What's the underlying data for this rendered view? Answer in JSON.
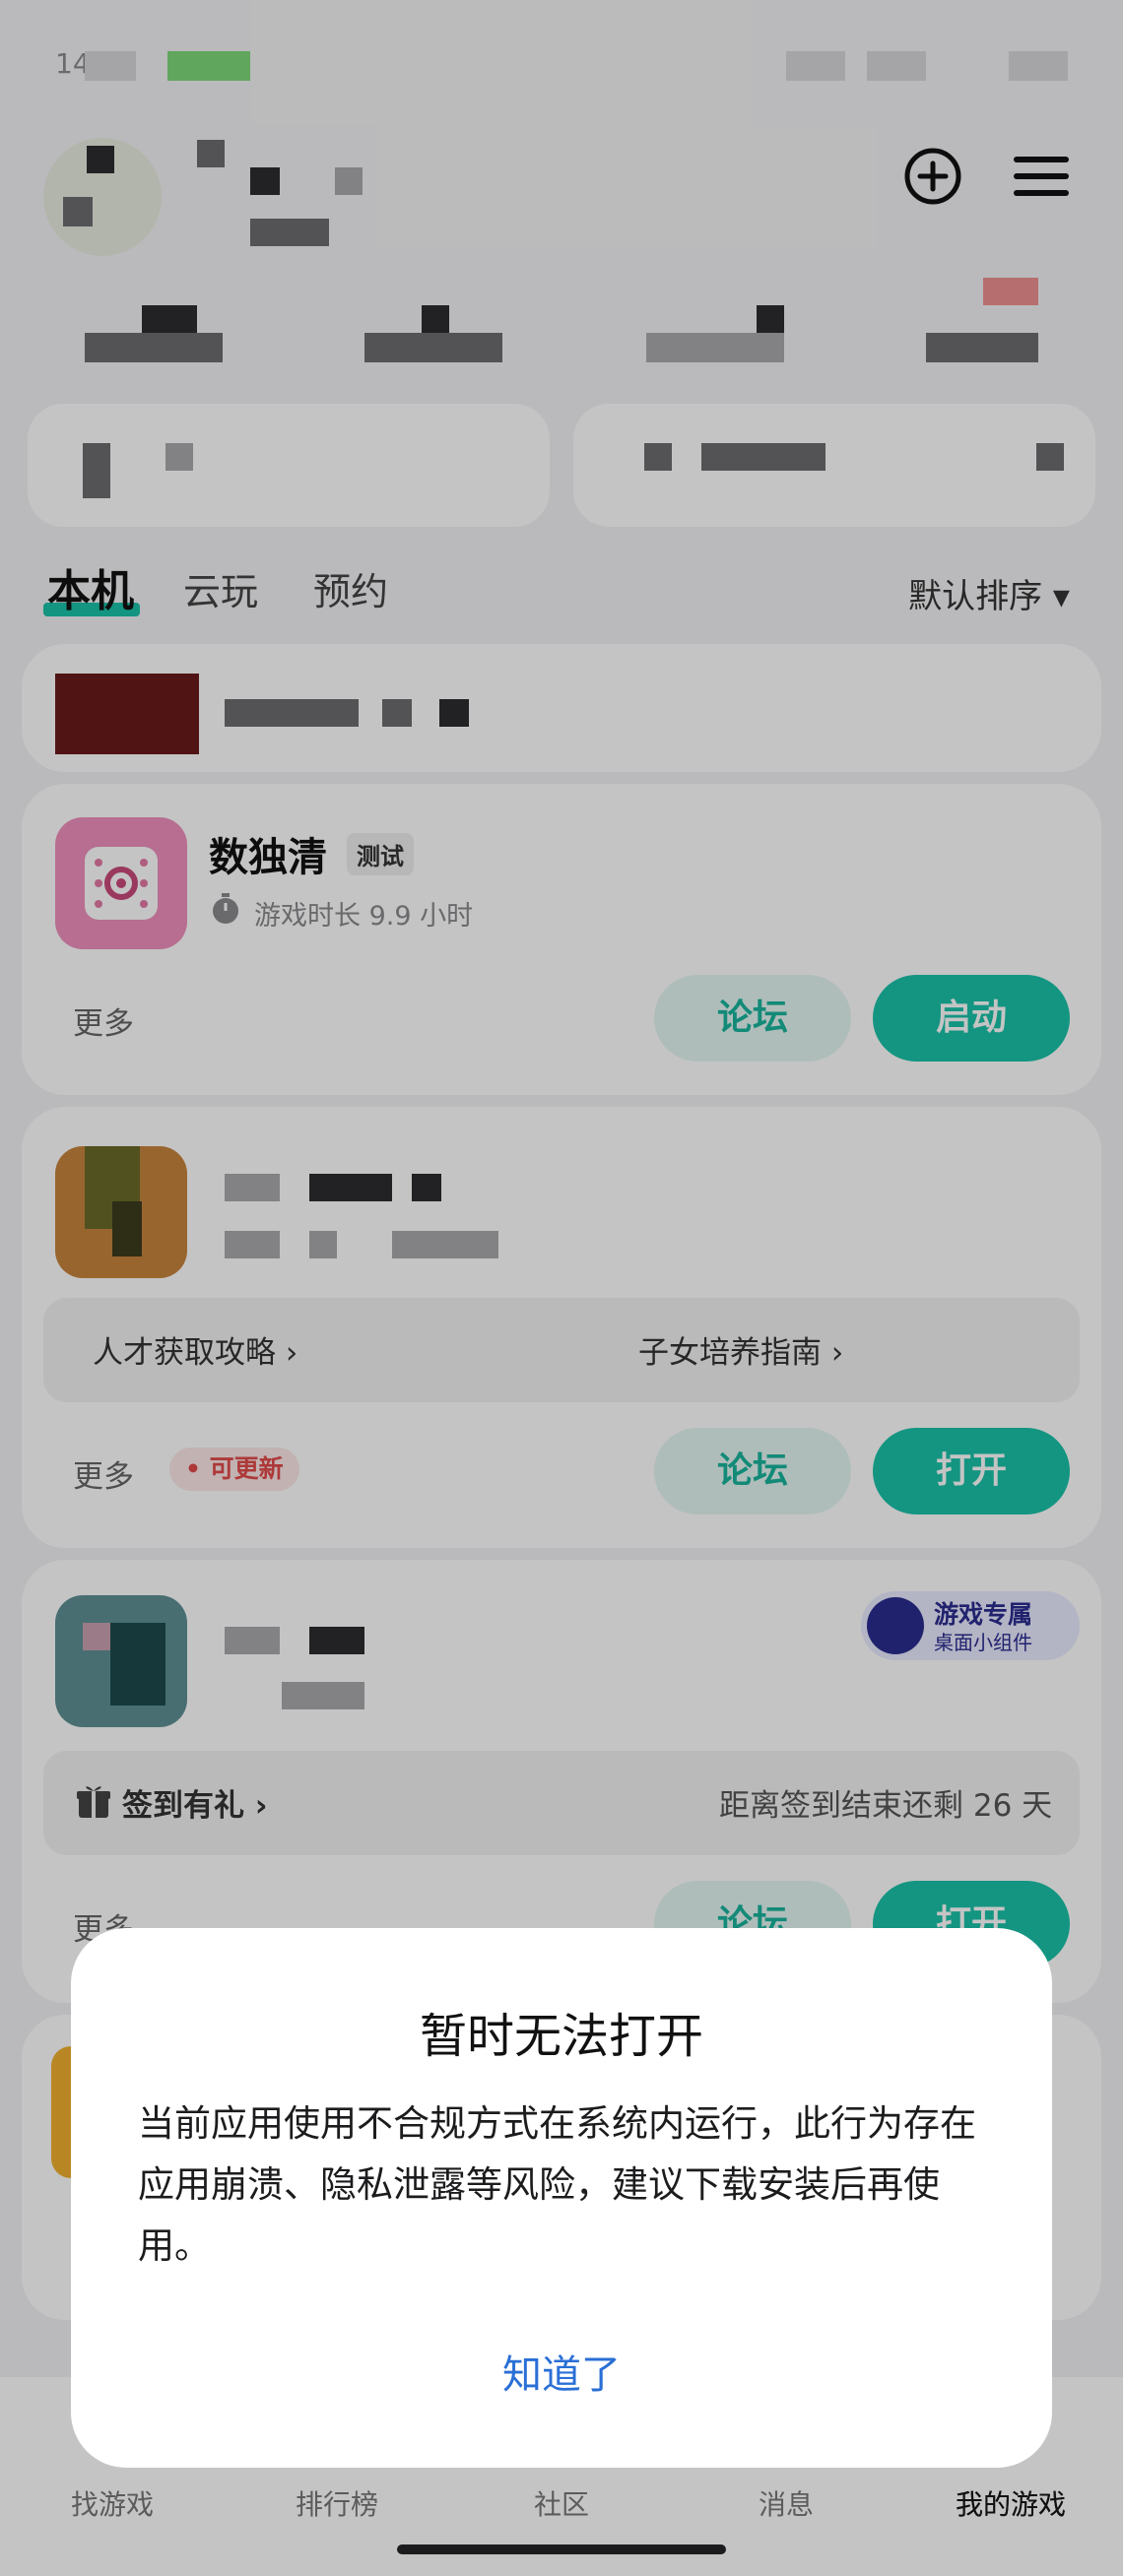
{
  "status_bar": {
    "time": "14"
  },
  "tabs": [
    {
      "label": "本机",
      "active": true
    },
    {
      "label": "云玩",
      "active": false
    },
    {
      "label": "预约",
      "active": false
    }
  ],
  "sort": {
    "label": "默认排序 ▾"
  },
  "games": [
    {
      "name": "数独清",
      "badge": "测试",
      "playtime": "游戏时长 9.9 小时",
      "more": "更多",
      "forum_label": "论坛",
      "action_label": "启动"
    },
    {
      "strip_left": "人才获取攻略 ›",
      "strip_right": "子女培养指南 ›",
      "more": "更多",
      "update_badge": "• 可更新",
      "forum_label": "论坛",
      "action_label": "打开"
    },
    {
      "widget_title": "游戏专属",
      "widget_sub": "桌面小组件",
      "strip_left": "签到有礼 ›",
      "strip_right": "距离签到结束还剩 26 天",
      "more": "更多",
      "forum_label": "论坛",
      "action_label": "打开"
    }
  ],
  "bottom_nav": [
    {
      "label": "找游戏",
      "icon": "search-games-icon",
      "active": false
    },
    {
      "label": "排行榜",
      "icon": "ranking-icon",
      "active": false
    },
    {
      "label": "社区",
      "icon": "community-icon",
      "active": false
    },
    {
      "label": "消息",
      "icon": "message-icon",
      "active": false
    },
    {
      "label": "我的游戏",
      "icon": "my-games-icon",
      "active": true
    }
  ],
  "dialog": {
    "title": "暂时无法打开",
    "message": "当前应用使用不合规方式在系统内运行，此行为存在应用崩溃、隐私泄露等风险，建议下载安装后再使用。",
    "confirm_label": "知道了"
  },
  "colors": {
    "accent": "#19c2a8",
    "dialog_link": "#2a6fd6",
    "update_red": "#e24b4b"
  }
}
